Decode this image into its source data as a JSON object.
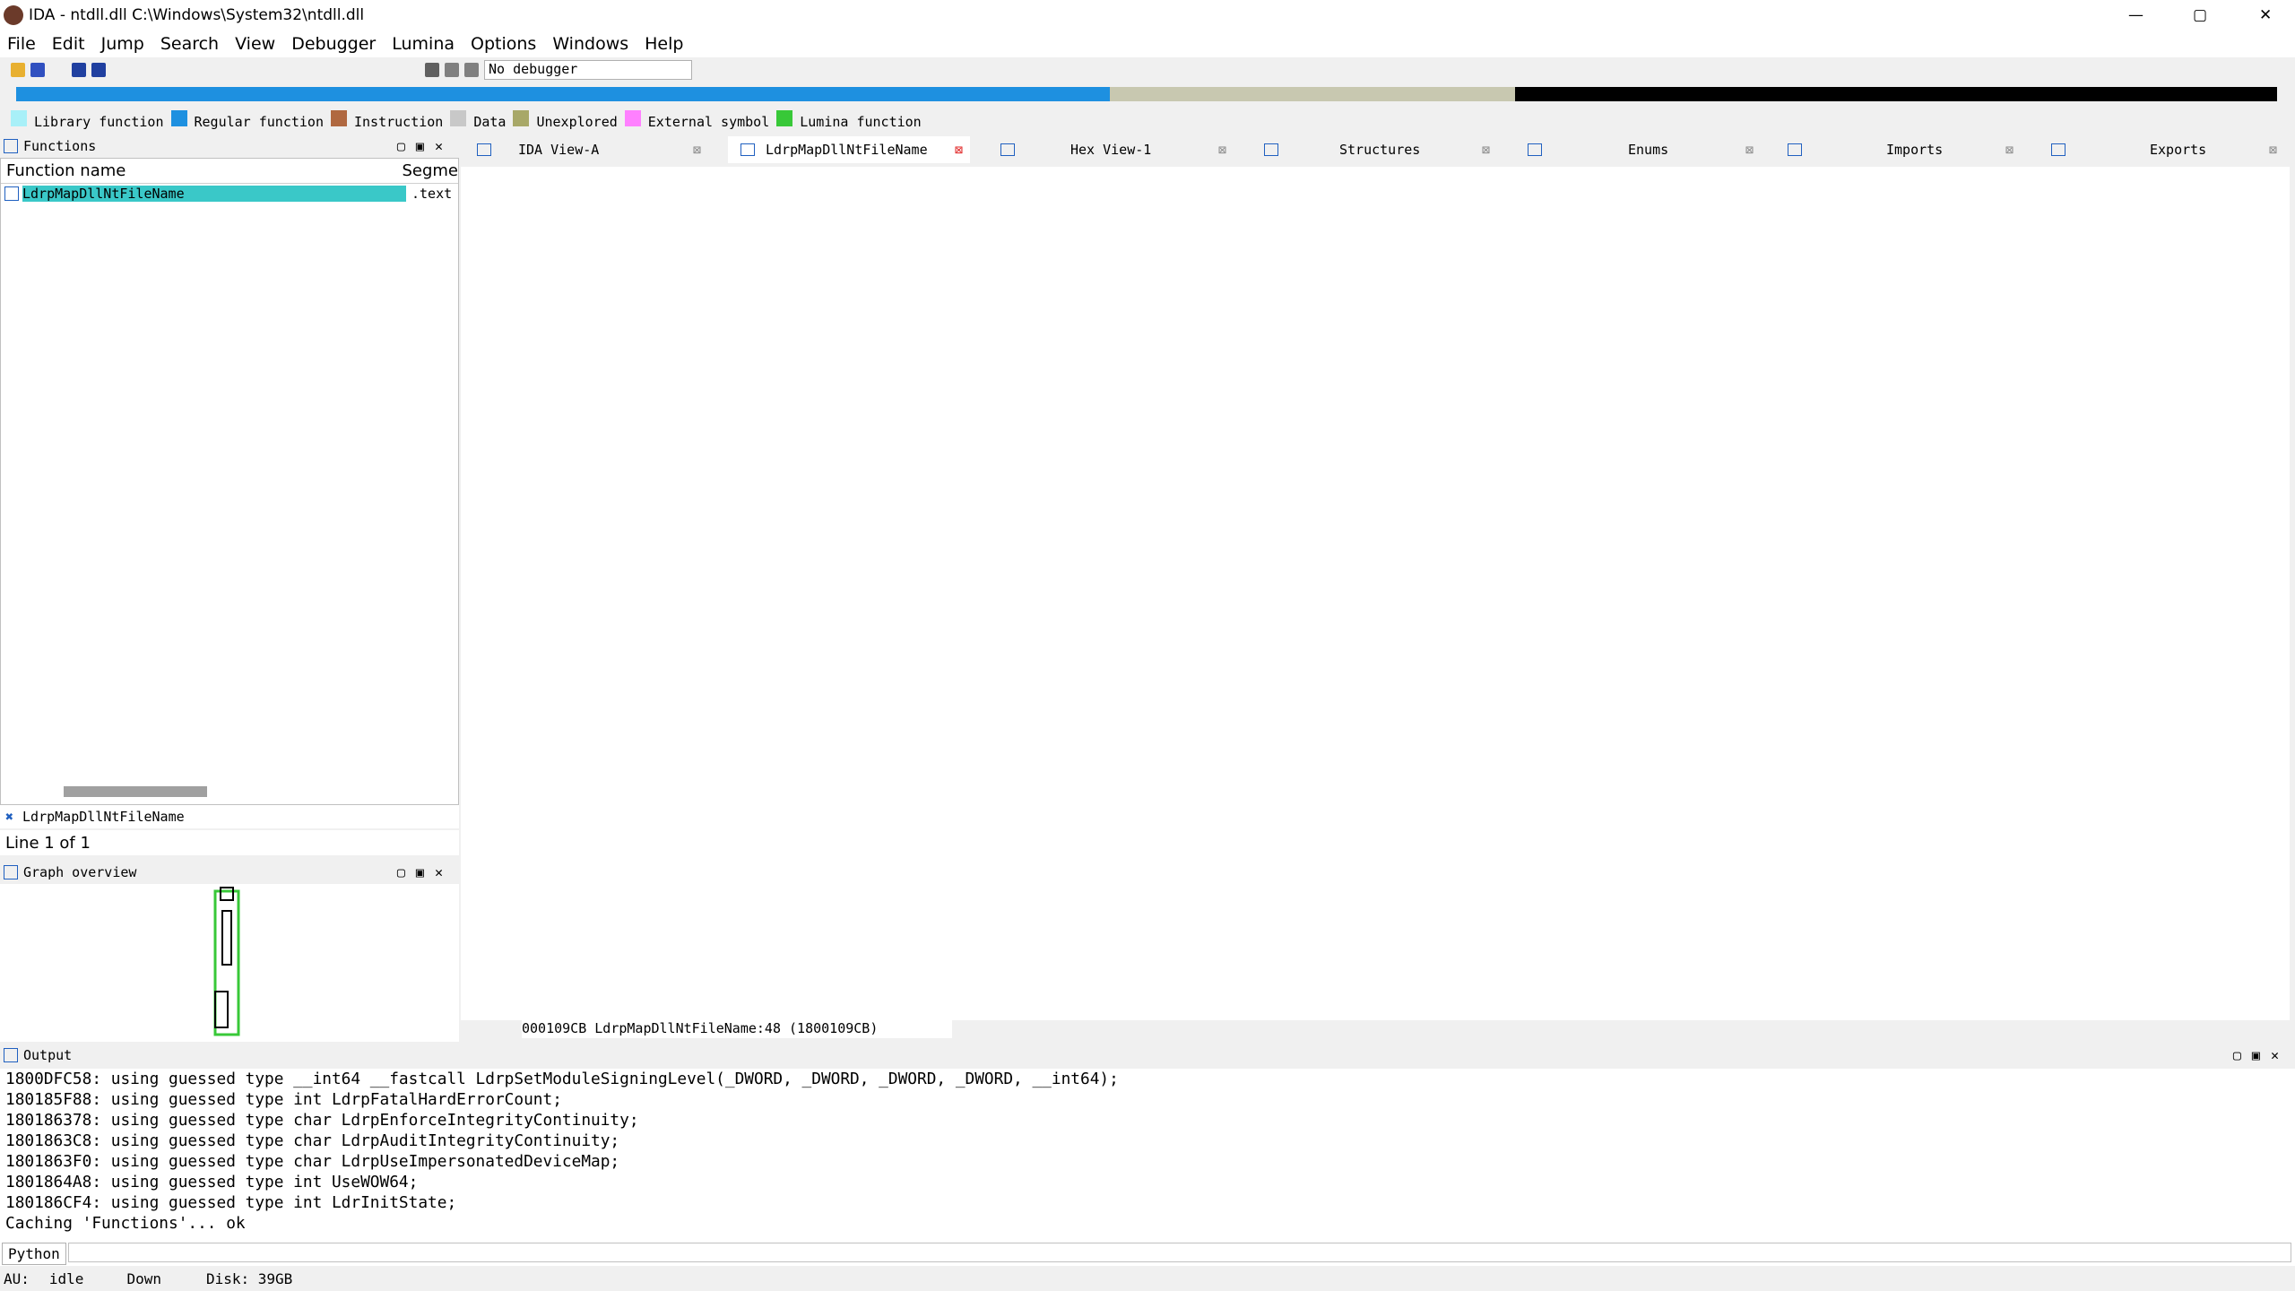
{
  "window": {
    "title": "IDA - ntdll.dll C:\\Windows\\System32\\ntdll.dll"
  },
  "menu": [
    "File",
    "Edit",
    "Jump",
    "Search",
    "View",
    "Debugger",
    "Lumina",
    "Options",
    "Windows",
    "Help"
  ],
  "toolbar": {
    "debugger_select": "No debugger"
  },
  "legend": [
    {
      "label": "Library function",
      "color": "#a8f0f8"
    },
    {
      "label": "Regular function",
      "color": "#1e90e0"
    },
    {
      "label": "Instruction",
      "color": "#b06840"
    },
    {
      "label": "Data",
      "color": "#c8c8c8"
    },
    {
      "label": "Unexplored",
      "color": "#a8a868"
    },
    {
      "label": "External symbol",
      "color": "#ff80ff"
    },
    {
      "label": "Lumina function",
      "color": "#38c838"
    }
  ],
  "functions_panel": {
    "title": "Functions",
    "col_name": "Function name",
    "col_segment": "Segme",
    "rows": [
      {
        "name": "LdrpMapDllNtFileName",
        "segment": ".text"
      }
    ],
    "filter_text": "LdrpMapDllNtFileName",
    "line_status": "Line 1 of 1"
  },
  "graph_panel": {
    "title": "Graph overview"
  },
  "tabs": [
    {
      "label": "IDA View-A"
    },
    {
      "label": "LdrpMapDllNtFileName"
    },
    {
      "label": "Hex View-1"
    },
    {
      "label": "Structures"
    },
    {
      "label": "Enums"
    },
    {
      "label": "Imports"
    },
    {
      "label": "Exports"
    }
  ],
  "code": {
    "status": "000109CB LdrpMapDllNtFileName:48 (1800109CB)"
  },
  "output_panel": {
    "title": "Output",
    "lines": [
      "1800DFC58: using guessed type __int64 __fastcall LdrpSetModuleSigningLevel(_DWORD, _DWORD, _DWORD, _DWORD, __int64);",
      "180185F88: using guessed type int LdrpFatalHardErrorCount;",
      "180186378: using guessed type char LdrpEnforceIntegrityContinuity;",
      "1801863C8: using guessed type char LdrpAuditIntegrityContinuity;",
      "1801863F0: using guessed type char LdrpUseImpersonatedDeviceMap;",
      "1801864A8: using guessed type int UseWOW64;",
      "180186CF4: using guessed type int LdrInitState;",
      "Caching 'Functions'... ok"
    ]
  },
  "python": {
    "label": "Python"
  },
  "status": {
    "au": "AU:",
    "state": "idle",
    "direction": "Down",
    "disk": "Disk: 39GB"
  }
}
